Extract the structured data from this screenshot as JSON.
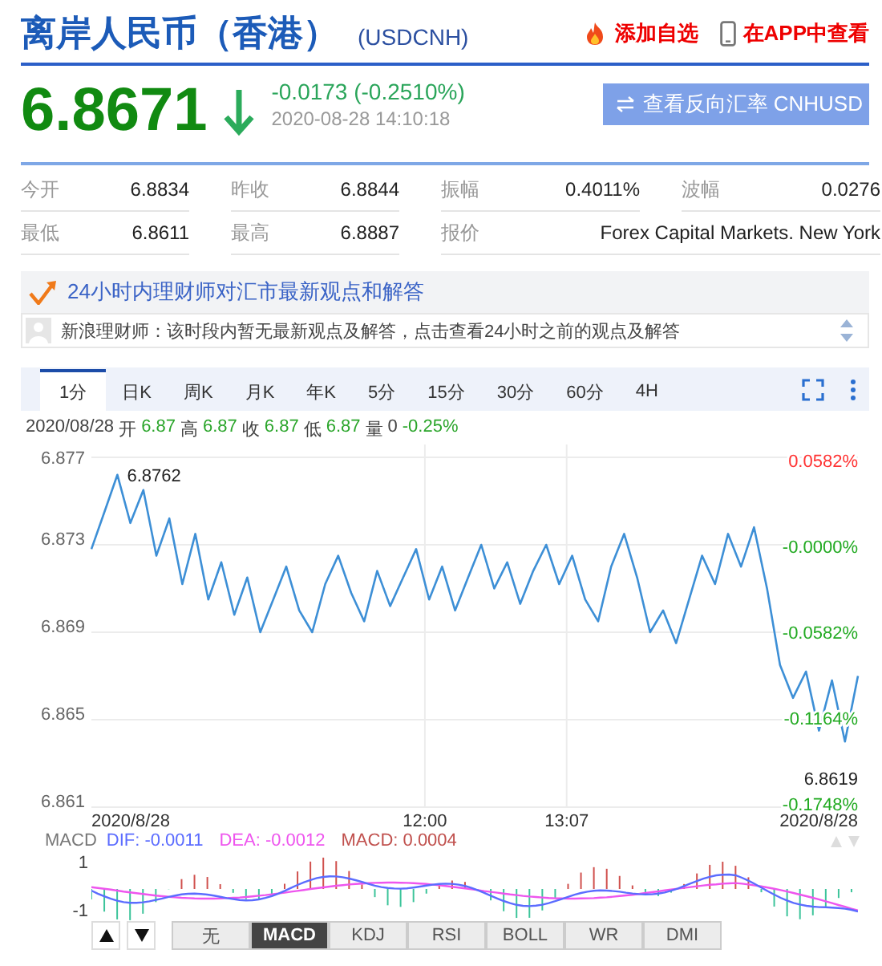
{
  "header": {
    "title": "离岸人民币（香港）",
    "code": "(USDCNH)",
    "actions": [
      {
        "kind": "fire",
        "label": "添加自选"
      },
      {
        "kind": "phone",
        "label": "在APP中查看"
      }
    ]
  },
  "quote": {
    "price": "6.8671",
    "falling": true,
    "change": "-0.0173 (-0.2510%)",
    "time": "2020-08-28 14:10:18",
    "reverse_button": "查看反向汇率 CNHUSD"
  },
  "stats": [
    {
      "label": "今开",
      "value": "6.8834"
    },
    {
      "label": "昨收",
      "value": "6.8844"
    },
    {
      "label": "振幅",
      "value": "0.4011%"
    },
    {
      "label": "波幅",
      "value": "0.0276"
    },
    {
      "label": "最低",
      "value": "6.8611"
    },
    {
      "label": "最高",
      "value": "6.8887"
    },
    {
      "label": "报价",
      "value": "Forex Capital Markets. New York"
    }
  ],
  "experts": {
    "title": "24小时内理财师对汇市最新观点和解答",
    "message": "新浪理财师：该时段内暂无最新观点及解答，点击查看24小时之前的观点及解答"
  },
  "tabs": [
    {
      "label": "1分",
      "selected": true
    },
    {
      "label": "日K",
      "selected": false
    },
    {
      "label": "周K",
      "selected": false
    },
    {
      "label": "月K",
      "selected": false
    },
    {
      "label": "年K",
      "selected": false
    },
    {
      "label": "5分",
      "selected": false
    },
    {
      "label": "15分",
      "selected": false
    },
    {
      "label": "30分",
      "selected": false
    },
    {
      "label": "60分",
      "selected": false
    },
    {
      "label": "4H",
      "selected": false
    }
  ],
  "info": {
    "date": "2020/08/28",
    "items": [
      {
        "label": "开",
        "value": "6.87"
      },
      {
        "label": "高",
        "value": "6.87"
      },
      {
        "label": "收",
        "value": "6.87"
      },
      {
        "label": "低",
        "value": "6.87"
      }
    ],
    "volume_label": "量",
    "volume": "0",
    "change": "-0.25%"
  },
  "chart": {
    "chart_data": {
      "type": "line",
      "ylim": [
        6.861,
        6.877
      ],
      "yticks": [
        6.861,
        6.865,
        6.869,
        6.873,
        6.877
      ],
      "grid": true,
      "series": [
        {
          "color": "#3d8fd6",
          "values": [
            6.8728,
            6.8745,
            6.8762,
            6.874,
            6.8755,
            6.8725,
            6.8742,
            6.8712,
            6.8735,
            6.8705,
            6.8722,
            6.8698,
            6.8715,
            6.869,
            6.8705,
            6.872,
            6.87,
            6.869,
            6.8712,
            6.8725,
            6.8708,
            6.8695,
            6.8718,
            6.8702,
            6.8715,
            6.8728,
            6.8705,
            6.872,
            6.87,
            6.8715,
            6.873,
            6.871,
            6.8722,
            6.8703,
            6.8718,
            6.873,
            6.8712,
            6.8725,
            6.8705,
            6.8695,
            6.872,
            6.8735,
            6.8715,
            6.869,
            6.87,
            6.8685,
            6.8705,
            6.8725,
            6.8712,
            6.8735,
            6.872,
            6.8738,
            6.871,
            6.8675,
            6.866,
            6.8672,
            6.8645,
            6.8668,
            6.864,
            6.867
          ]
        }
      ],
      "annotations": [
        {
          "text": "6.8762"
        },
        {
          "text": "6.8619"
        }
      ]
    },
    "x_labels": [
      "2020/8/28",
      "12:00",
      "13:07",
      "2020/8/28"
    ],
    "right_labels": [
      {
        "text": "0.0582%",
        "color": "#ff3333"
      },
      {
        "text": "-0.0000%",
        "color": "#22aa22"
      },
      {
        "text": "-0.0582%",
        "color": "#22aa22"
      },
      {
        "text": "-0.1164%",
        "color": "#22aa22"
      },
      {
        "text": "-0.1748%",
        "color": "#22aa22"
      }
    ]
  },
  "macd": {
    "label": "MACD",
    "values": [
      {
        "text": "DIF: -0.0011",
        "color": "#5b6cff"
      },
      {
        "text": "DEA: -0.0012",
        "color": "#ee55ee"
      },
      {
        "text": "MACD: 0.0004",
        "color": "#c0504d"
      }
    ],
    "yticks": [
      "1",
      "-1"
    ]
  },
  "indicator_tabs": [
    {
      "label": "无",
      "selected": false
    },
    {
      "label": "MACD",
      "selected": true
    },
    {
      "label": "KDJ",
      "selected": false
    },
    {
      "label": "RSI",
      "selected": false
    },
    {
      "label": "BOLL",
      "selected": false
    },
    {
      "label": "WR",
      "selected": false
    },
    {
      "label": "DMI",
      "selected": false
    }
  ]
}
